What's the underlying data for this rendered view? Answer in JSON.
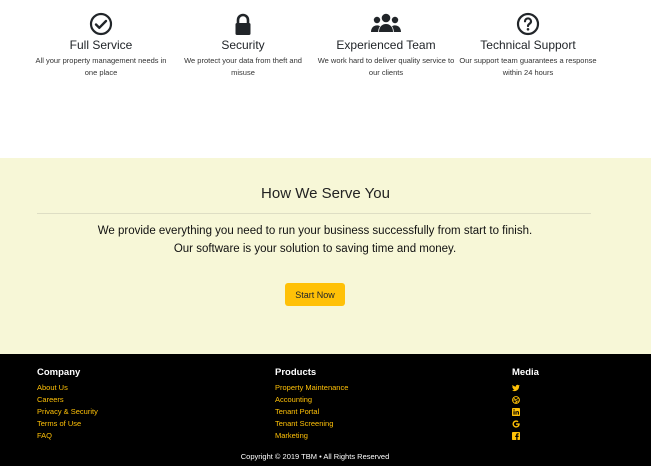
{
  "features": [
    {
      "icon": "check-circle-icon",
      "title": "Full Service",
      "desc": "All your property management needs in one place"
    },
    {
      "icon": "lock-icon",
      "title": "Security",
      "desc": "We protect your data from theft and misuse"
    },
    {
      "icon": "users-icon",
      "title": "Experienced Team",
      "desc": "We work hard to deliver quality service to our clients"
    },
    {
      "icon": "question-circle-icon",
      "title": "Technical Support",
      "desc": "Our support team guarantees a response within 24 hours"
    }
  ],
  "serve": {
    "title": "How We Serve You",
    "line1": "We provide everything you need to run your business successfully from start to finish.",
    "line2": "Our software is your solution to saving time and money.",
    "cta": "Start Now"
  },
  "footer": {
    "company": {
      "title": "Company",
      "links": [
        "About Us",
        "Careers",
        "Privacy & Security",
        "Terms of Use",
        "FAQ"
      ]
    },
    "products": {
      "title": "Products",
      "links": [
        "Property Maintenance",
        "Accounting",
        "Tenant Portal",
        "Tenant Screening",
        "Marketing"
      ]
    },
    "media": {
      "title": "Media",
      "icons": [
        "twitter-icon",
        "dribbble-icon",
        "linkedin-icon",
        "google-icon",
        "facebook-icon"
      ]
    },
    "copyright": "Copyright © 2019 TBM • All Rights Reserved"
  },
  "colors": {
    "accent": "#ffc107",
    "band": "#f7f7d7",
    "footer": "#000000"
  }
}
